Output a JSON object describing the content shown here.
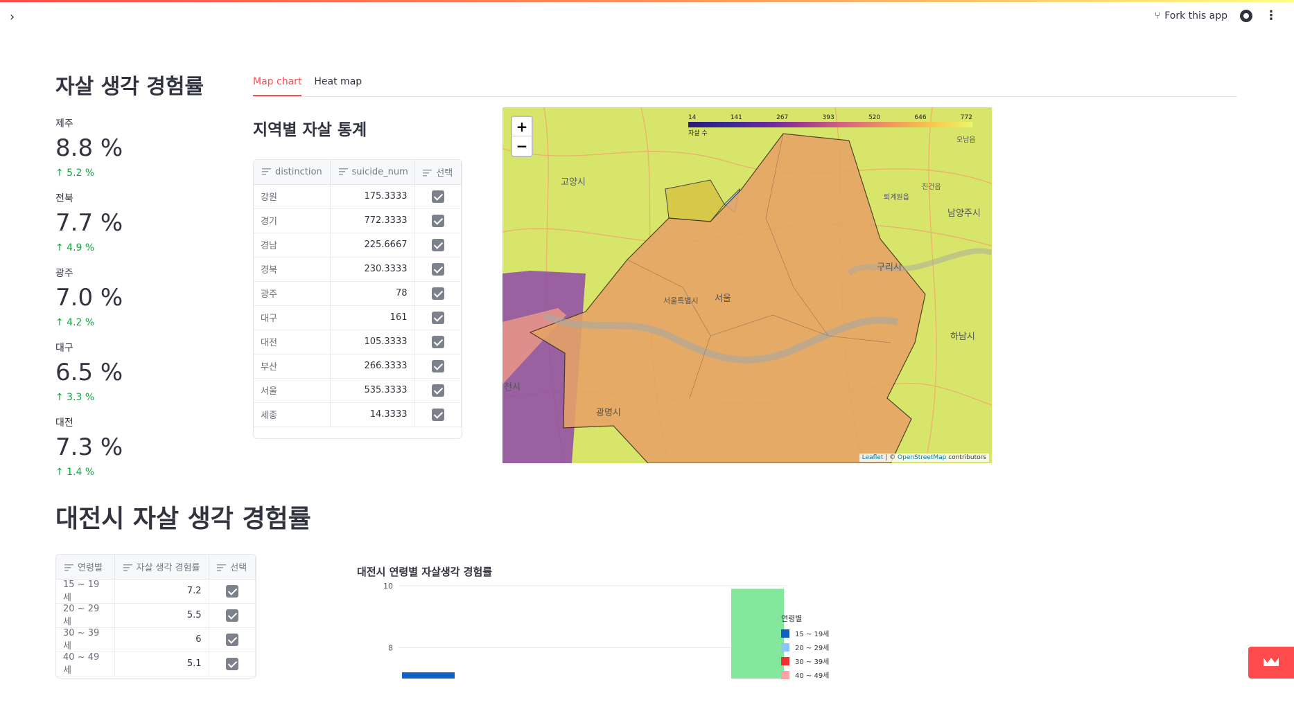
{
  "app": {
    "fork_label": "Fork this app"
  },
  "metrics": {
    "title": "자살 생각 경험률",
    "items": [
      {
        "label": "제주",
        "value": "8.8 %",
        "delta": "↑ 5.2 %"
      },
      {
        "label": "전북",
        "value": "7.7 %",
        "delta": "↑ 4.9 %"
      },
      {
        "label": "광주",
        "value": "7.0 %",
        "delta": "↑ 4.2 %"
      },
      {
        "label": "대구",
        "value": "6.5 %",
        "delta": "↑ 3.3 %"
      },
      {
        "label": "대전",
        "value": "7.3 %",
        "delta": "↑ 1.4 %"
      }
    ]
  },
  "tabs": [
    {
      "label": "Map chart",
      "active": true
    },
    {
      "label": "Heat map",
      "active": false
    }
  ],
  "region_section": {
    "title": "지역별 자살 통계",
    "columns": [
      "distinction",
      "suicide_num",
      "선택"
    ],
    "rows": [
      {
        "region": "강원",
        "num": "175.3333"
      },
      {
        "region": "경기",
        "num": "772.3333"
      },
      {
        "region": "경남",
        "num": "225.6667"
      },
      {
        "region": "경북",
        "num": "230.3333"
      },
      {
        "region": "광주",
        "num": "78"
      },
      {
        "region": "대구",
        "num": "161"
      },
      {
        "region": "대전",
        "num": "105.3333"
      },
      {
        "region": "부산",
        "num": "266.3333"
      },
      {
        "region": "서울",
        "num": "535.3333"
      },
      {
        "region": "세종",
        "num": "14.3333"
      }
    ]
  },
  "map": {
    "zoom_in": "+",
    "zoom_out": "−",
    "legend_ticks": [
      "14",
      "141",
      "267",
      "393",
      "520",
      "646",
      "772"
    ],
    "legend_caption": "자살 수",
    "city_labels": [
      "고양시",
      "서울",
      "서울특별시",
      "구리시",
      "남양주시",
      "하남시",
      "광명시",
      "진건읍",
      "퇴계원읍",
      "오남읍",
      "천시"
    ],
    "attribution_leaflet": "Leaflet",
    "attribution_sep": " | © ",
    "attribution_osm": "OpenStreetMap",
    "attribution_rest": " contributors"
  },
  "daejeon": {
    "title": "대전시 자살 생각 경험률",
    "columns": [
      "연령별",
      "자살 생각 경험률",
      "선택"
    ],
    "rows": [
      {
        "age": "15 ~ 19세",
        "rate": "7.2"
      },
      {
        "age": "20 ~ 29세",
        "rate": "5.5"
      },
      {
        "age": "30 ~ 39세",
        "rate": "6"
      },
      {
        "age": "40 ~ 49세",
        "rate": "5.1"
      }
    ]
  },
  "chart_data": {
    "type": "bar",
    "title": "대전시 연령별 자살생각 경험률",
    "y_ticks": [
      "10",
      "8"
    ],
    "legend_title": "연령별",
    "series": [
      {
        "name": "15 ~ 19세",
        "color": "#0f62c4"
      },
      {
        "name": "20 ~ 29세",
        "color": "#8ac6f7"
      },
      {
        "name": "30 ~ 39세",
        "color": "#f0312f"
      },
      {
        "name": "40 ~ 49세",
        "color": "#f8a3a8"
      }
    ],
    "visible_bars": [
      {
        "color": "#0f62c4",
        "value": 7.2
      },
      {
        "color": "#84e89c",
        "value": 9.9
      }
    ],
    "ylim_visible": [
      7,
      10.4
    ]
  }
}
